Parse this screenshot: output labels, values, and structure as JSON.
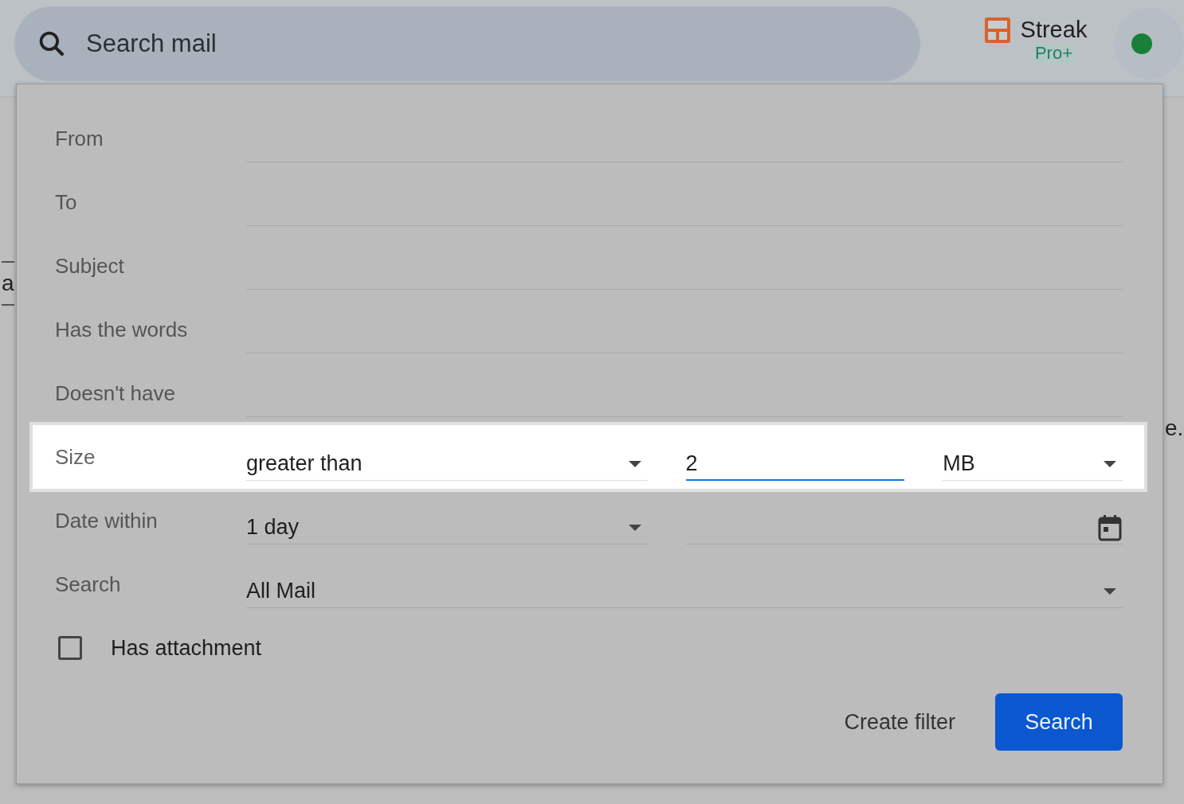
{
  "search_bar": {
    "placeholder": "Search mail"
  },
  "streak": {
    "name": "Streak",
    "badge": "Pro+"
  },
  "background_fragments": [
    "a",
    "e."
  ],
  "filter_form": {
    "rows": [
      {
        "kind": "text",
        "label": "From",
        "highlighted": false
      },
      {
        "kind": "text",
        "label": "To",
        "highlighted": false
      },
      {
        "kind": "text",
        "label": "Subject",
        "highlighted": false
      },
      {
        "kind": "text",
        "label": "Has the words",
        "highlighted": false
      },
      {
        "kind": "text",
        "label": "Doesn't have",
        "highlighted": false
      },
      {
        "kind": "size",
        "label": "Size",
        "highlighted": true,
        "operator": "greater than",
        "value": "2",
        "unit": "MB"
      },
      {
        "kind": "date",
        "label": "Date within",
        "highlighted": false,
        "range": "1 day"
      },
      {
        "kind": "select",
        "label": "Search",
        "highlighted": false,
        "value": "All Mail"
      }
    ],
    "has_attachment": {
      "label": "Has attachment",
      "checked": false
    },
    "actions": [
      {
        "kind": "text",
        "label": "Create filter"
      },
      {
        "kind": "primary",
        "label": "Search"
      }
    ]
  }
}
